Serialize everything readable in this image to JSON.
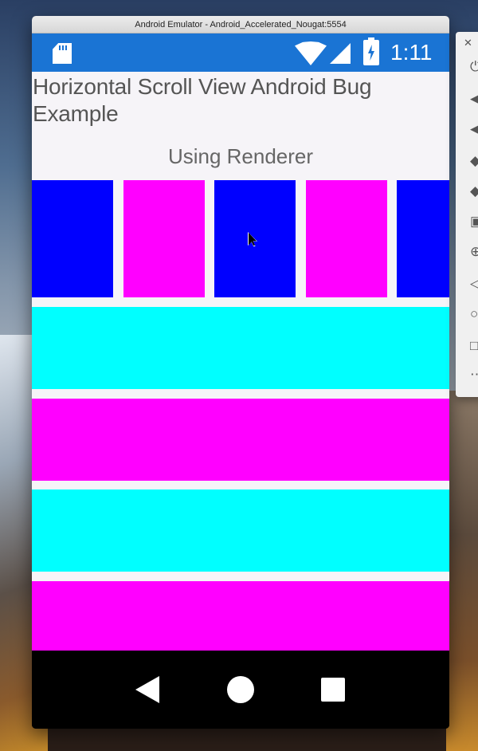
{
  "window": {
    "title": "Android Emulator - Android_Accelerated_Nougat:5554"
  },
  "status_bar": {
    "time": "1:11",
    "background_color": "#1a74d4",
    "icons": [
      "sd-card-icon",
      "wifi-icon",
      "cell-signal-icon",
      "battery-charging-icon"
    ]
  },
  "app": {
    "title": "Horizontal Scroll View Android Bug Example",
    "subtitle": "Using Renderer"
  },
  "horizontal_scroll": {
    "item_colors": [
      "#0000ff",
      "#ff00ff",
      "#0000ff",
      "#ff00ff",
      "#0000ff"
    ]
  },
  "vertical_list": {
    "row_colors": [
      "#00ffff",
      "#ff00ff",
      "#00ffff",
      "#ff00ff"
    ]
  },
  "navigation_bar": {
    "icons": [
      "back-icon",
      "home-icon",
      "recents-icon"
    ]
  },
  "side_toolbar": {
    "icons": [
      "close-icon",
      "power-icon",
      "volume-up-icon",
      "volume-down-icon",
      "rotate-left-icon",
      "rotate-right-icon",
      "camera-icon",
      "zoom-icon",
      "back-icon",
      "home-icon",
      "overview-icon",
      "more-icon"
    ]
  }
}
